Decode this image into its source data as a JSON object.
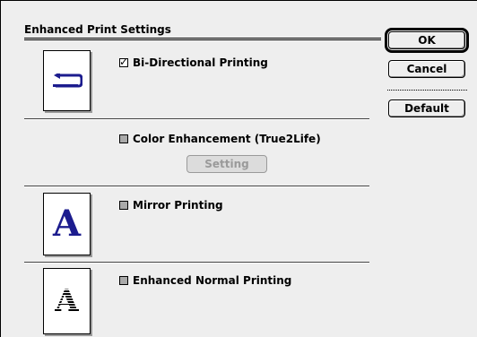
{
  "dialog": {
    "title": "Enhanced Print Settings"
  },
  "buttons": {
    "ok": "OK",
    "cancel": "Cancel",
    "default": "Default",
    "setting": "Setting"
  },
  "options": {
    "bidirectional": {
      "label": "Bi-Directional Printing",
      "checked": true
    },
    "color_enhancement": {
      "label": "Color Enhancement (True2Life)",
      "checked": false
    },
    "mirror": {
      "label": "Mirror Printing",
      "checked": false
    },
    "enhanced_normal": {
      "label": "Enhanced Normal Printing",
      "checked": false
    }
  },
  "previews": {
    "bidirectional_icon": "bidirectional-arrow-icon",
    "mirror_glyph": "A",
    "normal_glyph": "A"
  },
  "colors": {
    "mirror_glyph": "#1c1c8e",
    "dialog_bg": "#eeeeee"
  }
}
